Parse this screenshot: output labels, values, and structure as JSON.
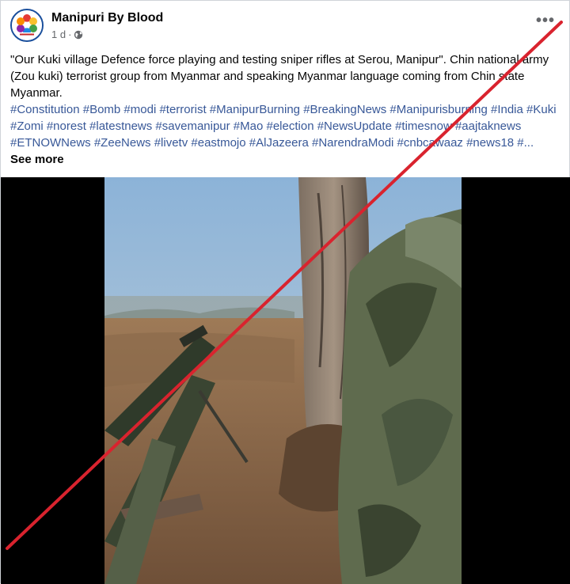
{
  "post": {
    "page_name": "Manipuri By Blood",
    "time": "1 d",
    "separator": "·",
    "audience_icon": "globe-icon",
    "more_label": "•••",
    "caption": "\"Our Kuki village Defence force playing and testing sniper rifles at Serou, Manipur\". Chin national army (Zou kuki)  terrorist group from Myanmar and  speaking Myanmar language coming from Chin state Myanmar.",
    "hashtags": " #Constitution #Bomb #modi #terrorist #ManipurBurning #BreakingNews #Manipurisburning #India #Kuki #Zomi #norest #latestnews #savemanipur #Mao #election #NewsUpdate #timesnow #aajtaknews #ETNOWNews #ZeeNews #livetv #eastmojo #AlJazeera #NarendraModi #cnbcawaaz #news18 #...",
    "see_more": " See more"
  },
  "colors": {
    "link": "#385898",
    "cross": "#d9232e",
    "avatar_border": "#1a4f9c"
  },
  "media": {
    "type": "video-thumbnail",
    "overlay": "red-diagonal-cross-line"
  }
}
